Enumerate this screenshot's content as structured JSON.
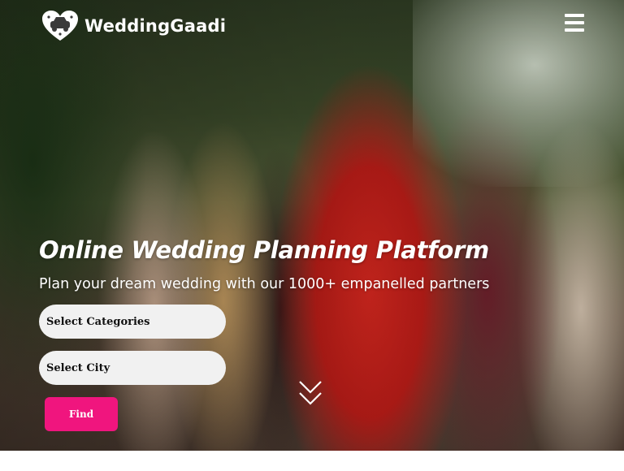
{
  "brand": {
    "name": "WeddingGaadi",
    "logo_icon": "heart-car-logo-icon"
  },
  "header": {
    "menu_icon": "hamburger-menu-icon"
  },
  "hero": {
    "title": "Online Wedding Planning Platform",
    "subtitle": "Plan your dream wedding with our 1000+ empanelled partners",
    "background": "photo of a bride in a red lehenga with bridesmaids"
  },
  "search": {
    "category_select": "Select Categories",
    "city_select": "Select City",
    "find_label": "Find"
  },
  "scroll_indicator": {
    "icon": "double-chevron-down-icon"
  },
  "colors": {
    "accent": "#f0157e",
    "text_light": "#ffffff",
    "select_bg": "#f1f1f1"
  }
}
